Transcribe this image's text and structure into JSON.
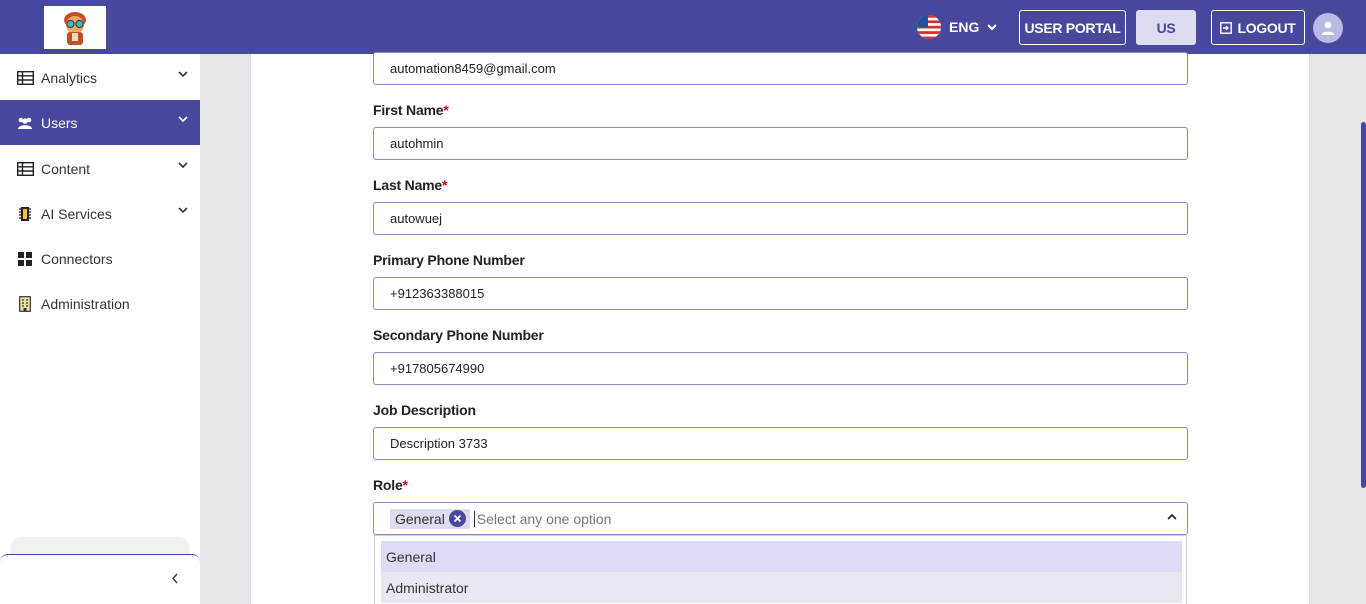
{
  "header": {
    "language": "ENG",
    "user_portal_label": "USER PORTAL",
    "region_label": "US",
    "logout_label": "LOGOUT",
    "brand_color": "#48489c"
  },
  "sidebar": {
    "items": [
      {
        "label": "Analytics",
        "icon": "table-icon",
        "expandable": true
      },
      {
        "label": "Users",
        "icon": "users-icon",
        "expandable": true,
        "active": true
      },
      {
        "label": "Content",
        "icon": "table-icon",
        "expandable": true
      },
      {
        "label": "AI Services",
        "icon": "chip-icon",
        "expandable": true
      },
      {
        "label": "Connectors",
        "icon": "grid-icon",
        "expandable": false
      },
      {
        "label": "Administration",
        "icon": "building-icon",
        "expandable": false
      }
    ],
    "collapse_icon": "chevron-left-icon"
  },
  "form": {
    "email": {
      "value": "automation8459@gmail.com"
    },
    "first_name": {
      "label": "First Name",
      "required_mark": "*",
      "value": "autohmin"
    },
    "last_name": {
      "label": "Last Name",
      "required_mark": "*",
      "value": "autowuej"
    },
    "primary_phone": {
      "label": "Primary Phone Number",
      "value": "+912363388015"
    },
    "secondary_phone": {
      "label": "Secondary Phone Number",
      "value": "+917805674990"
    },
    "job_description": {
      "label": "Job Description",
      "value": "Description 3733"
    },
    "role": {
      "label": "Role",
      "required_mark": "*",
      "selected_chip": "General",
      "placeholder": "Select any one option",
      "options": [
        "General",
        "Administrator"
      ]
    }
  }
}
